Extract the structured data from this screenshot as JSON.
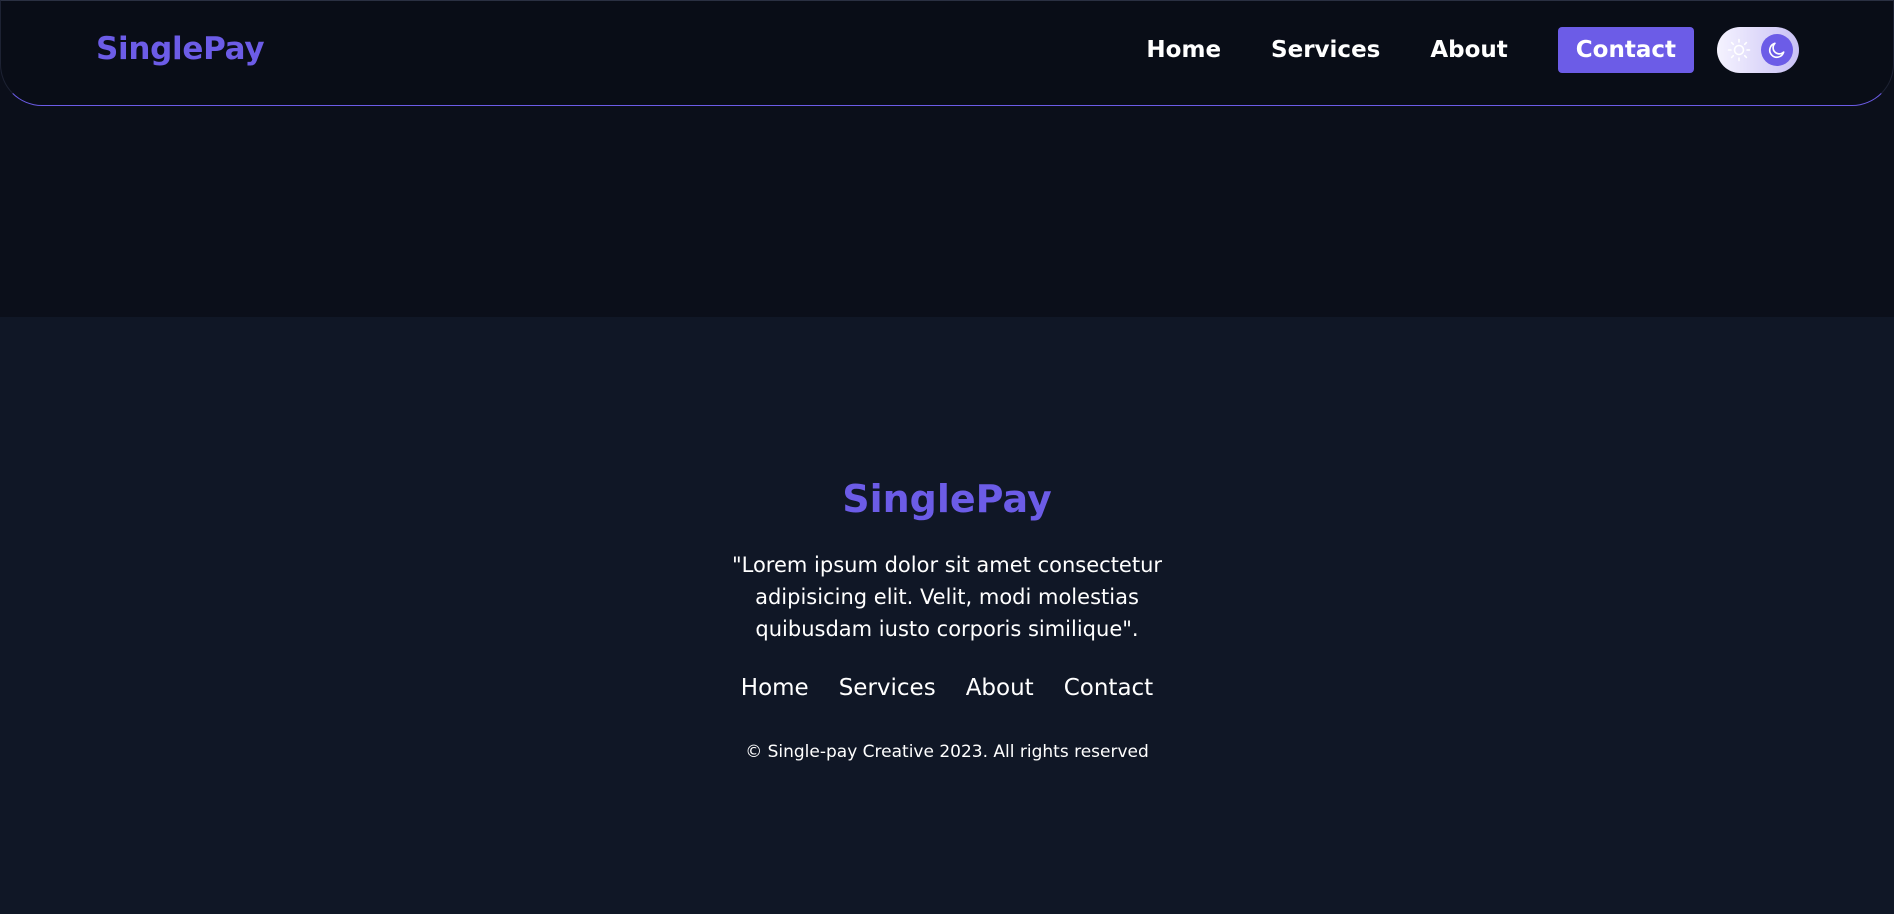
{
  "navbar": {
    "brand": "SinglePay",
    "links": [
      "Home",
      "Services",
      "About"
    ],
    "contact_label": "Contact",
    "theme_toggle": {
      "icons": [
        "sun-icon",
        "moon-icon"
      ],
      "active": "dark"
    }
  },
  "footer": {
    "brand": "SinglePay",
    "quote": "\"Lorem ipsum dolor sit amet consectetur adipisicing elit. Velit, modi molestias quibusdam iusto corporis similique\".",
    "links": [
      "Home",
      "Services",
      "About",
      "Contact"
    ],
    "copyright": "© Single-pay Creative 2023. All rights reserved"
  },
  "colors": {
    "accent": "#6c5ce7",
    "background": "#0b0f1a",
    "footer_background": "#101726",
    "text": "#ffffff"
  }
}
